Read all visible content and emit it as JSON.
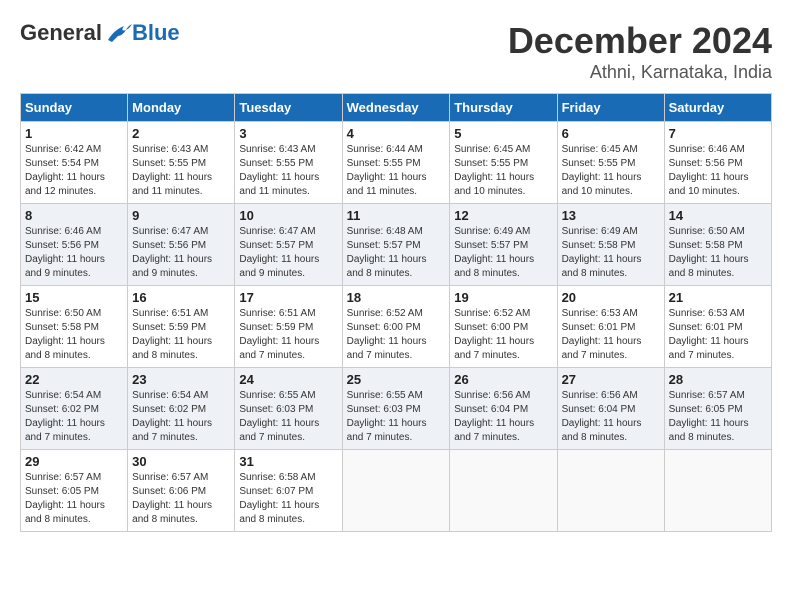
{
  "header": {
    "logo_general": "General",
    "logo_blue": "Blue",
    "month_title": "December 2024",
    "location": "Athni, Karnataka, India"
  },
  "days_of_week": [
    "Sunday",
    "Monday",
    "Tuesday",
    "Wednesday",
    "Thursday",
    "Friday",
    "Saturday"
  ],
  "weeks": [
    [
      {
        "day": 1,
        "sunrise": "6:42 AM",
        "sunset": "5:54 PM",
        "daylight": "11 hours and 12 minutes."
      },
      {
        "day": 2,
        "sunrise": "6:43 AM",
        "sunset": "5:55 PM",
        "daylight": "11 hours and 11 minutes."
      },
      {
        "day": 3,
        "sunrise": "6:43 AM",
        "sunset": "5:55 PM",
        "daylight": "11 hours and 11 minutes."
      },
      {
        "day": 4,
        "sunrise": "6:44 AM",
        "sunset": "5:55 PM",
        "daylight": "11 hours and 11 minutes."
      },
      {
        "day": 5,
        "sunrise": "6:45 AM",
        "sunset": "5:55 PM",
        "daylight": "11 hours and 10 minutes."
      },
      {
        "day": 6,
        "sunrise": "6:45 AM",
        "sunset": "5:55 PM",
        "daylight": "11 hours and 10 minutes."
      },
      {
        "day": 7,
        "sunrise": "6:46 AM",
        "sunset": "5:56 PM",
        "daylight": "11 hours and 10 minutes."
      }
    ],
    [
      {
        "day": 8,
        "sunrise": "6:46 AM",
        "sunset": "5:56 PM",
        "daylight": "11 hours and 9 minutes."
      },
      {
        "day": 9,
        "sunrise": "6:47 AM",
        "sunset": "5:56 PM",
        "daylight": "11 hours and 9 minutes."
      },
      {
        "day": 10,
        "sunrise": "6:47 AM",
        "sunset": "5:57 PM",
        "daylight": "11 hours and 9 minutes."
      },
      {
        "day": 11,
        "sunrise": "6:48 AM",
        "sunset": "5:57 PM",
        "daylight": "11 hours and 8 minutes."
      },
      {
        "day": 12,
        "sunrise": "6:49 AM",
        "sunset": "5:57 PM",
        "daylight": "11 hours and 8 minutes."
      },
      {
        "day": 13,
        "sunrise": "6:49 AM",
        "sunset": "5:58 PM",
        "daylight": "11 hours and 8 minutes."
      },
      {
        "day": 14,
        "sunrise": "6:50 AM",
        "sunset": "5:58 PM",
        "daylight": "11 hours and 8 minutes."
      }
    ],
    [
      {
        "day": 15,
        "sunrise": "6:50 AM",
        "sunset": "5:58 PM",
        "daylight": "11 hours and 8 minutes."
      },
      {
        "day": 16,
        "sunrise": "6:51 AM",
        "sunset": "5:59 PM",
        "daylight": "11 hours and 8 minutes."
      },
      {
        "day": 17,
        "sunrise": "6:51 AM",
        "sunset": "5:59 PM",
        "daylight": "11 hours and 7 minutes."
      },
      {
        "day": 18,
        "sunrise": "6:52 AM",
        "sunset": "6:00 PM",
        "daylight": "11 hours and 7 minutes."
      },
      {
        "day": 19,
        "sunrise": "6:52 AM",
        "sunset": "6:00 PM",
        "daylight": "11 hours and 7 minutes."
      },
      {
        "day": 20,
        "sunrise": "6:53 AM",
        "sunset": "6:01 PM",
        "daylight": "11 hours and 7 minutes."
      },
      {
        "day": 21,
        "sunrise": "6:53 AM",
        "sunset": "6:01 PM",
        "daylight": "11 hours and 7 minutes."
      }
    ],
    [
      {
        "day": 22,
        "sunrise": "6:54 AM",
        "sunset": "6:02 PM",
        "daylight": "11 hours and 7 minutes."
      },
      {
        "day": 23,
        "sunrise": "6:54 AM",
        "sunset": "6:02 PM",
        "daylight": "11 hours and 7 minutes."
      },
      {
        "day": 24,
        "sunrise": "6:55 AM",
        "sunset": "6:03 PM",
        "daylight": "11 hours and 7 minutes."
      },
      {
        "day": 25,
        "sunrise": "6:55 AM",
        "sunset": "6:03 PM",
        "daylight": "11 hours and 7 minutes."
      },
      {
        "day": 26,
        "sunrise": "6:56 AM",
        "sunset": "6:04 PM",
        "daylight": "11 hours and 7 minutes."
      },
      {
        "day": 27,
        "sunrise": "6:56 AM",
        "sunset": "6:04 PM",
        "daylight": "11 hours and 8 minutes."
      },
      {
        "day": 28,
        "sunrise": "6:57 AM",
        "sunset": "6:05 PM",
        "daylight": "11 hours and 8 minutes."
      }
    ],
    [
      {
        "day": 29,
        "sunrise": "6:57 AM",
        "sunset": "6:05 PM",
        "daylight": "11 hours and 8 minutes."
      },
      {
        "day": 30,
        "sunrise": "6:57 AM",
        "sunset": "6:06 PM",
        "daylight": "11 hours and 8 minutes."
      },
      {
        "day": 31,
        "sunrise": "6:58 AM",
        "sunset": "6:07 PM",
        "daylight": "11 hours and 8 minutes."
      },
      null,
      null,
      null,
      null
    ]
  ]
}
